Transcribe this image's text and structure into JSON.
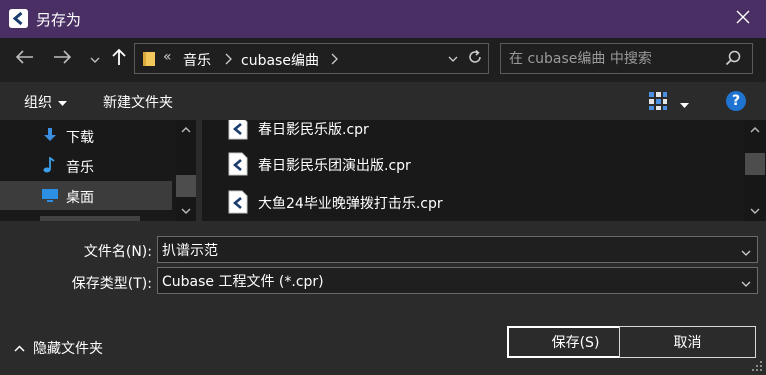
{
  "window": {
    "title": "另存为",
    "close_icon": "close-icon",
    "accent_title_bar": "#4a2f64"
  },
  "nav": {
    "back_icon": "arrow-left-icon",
    "forward_icon": "arrow-right-icon",
    "recent_icon": "chevron-down-icon",
    "up_icon": "arrow-up-icon",
    "breadcrumb_overflow": "«",
    "breadcrumb": [
      "音乐",
      "cubase编曲"
    ],
    "refresh_icon": "refresh-icon",
    "search_placeholder": "在 cubase编曲 中搜索"
  },
  "toolbar": {
    "organize_label": "组织",
    "new_folder_label": "新建文件夹",
    "help_label": "?"
  },
  "nav_pane": {
    "items": [
      {
        "label": "下载",
        "icon": "download-icon"
      },
      {
        "label": "音乐",
        "icon": "music-note-icon"
      },
      {
        "label": "桌面",
        "icon": "desktop-icon",
        "selected": true
      }
    ]
  },
  "files": [
    {
      "name": "春日影民乐版.cpr",
      "icon": "cubase-file-icon"
    },
    {
      "name": "春日影民乐团演出版.cpr",
      "icon": "cubase-file-icon"
    },
    {
      "name": "大鱼24毕业晚弹拨打击乐.cpr",
      "icon": "cubase-file-icon"
    }
  ],
  "form": {
    "filename_label": "文件名(N):",
    "filename_value": "扒谱示范",
    "filetype_label": "保存类型(T):",
    "filetype_value": "Cubase 工程文件 (*.cpr)"
  },
  "footer": {
    "hide_folders_label": "隐藏文件夹",
    "save_label": "保存(S)",
    "cancel_label": "取消"
  }
}
